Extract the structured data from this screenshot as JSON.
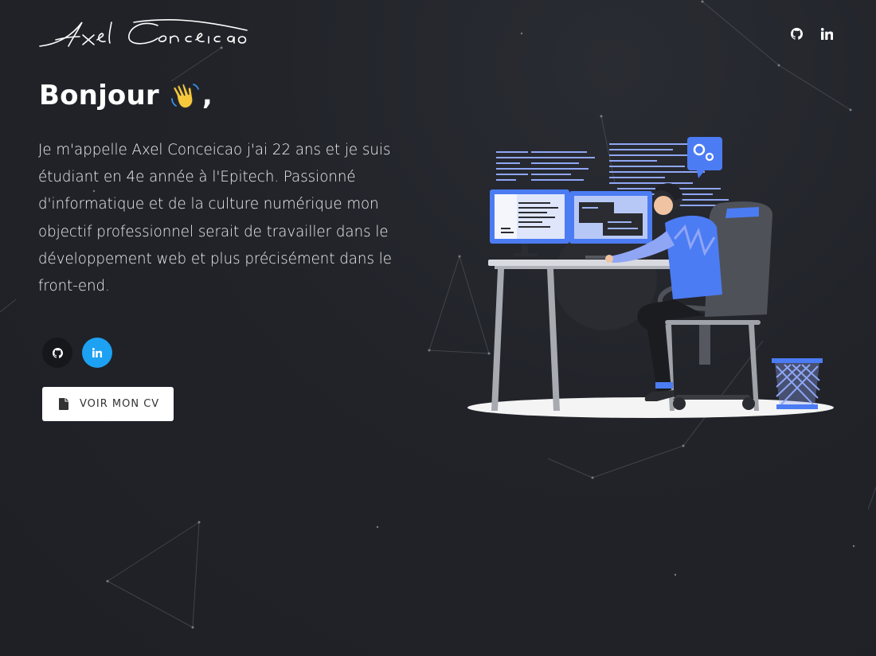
{
  "header": {
    "logo_text": "Axel Conceicao",
    "icons": [
      "github-icon",
      "linkedin-icon"
    ]
  },
  "hero": {
    "greeting": "Bonjour",
    "emoji": "waving-hand",
    "comma": ",",
    "intro": "Je m'appelle Axel Conceicao j'ai 22 ans et je suis étudiant en 4e année à l'Epitech. Passionné d'informatique et de la culture numérique mon objectif professionnel serait de travailler dans le développement web et plus précisément dans le front-end."
  },
  "social": {
    "github_icon": "github-icon",
    "linkedin_icon": "linkedin-icon",
    "github_bg": "#15171b",
    "linkedin_bg": "#1da1f2"
  },
  "cv_button": {
    "label": "VOIR MON CV",
    "icon": "document-icon"
  },
  "colors": {
    "background": "#1f2126",
    "accent_blue": "#4c7cf3",
    "text": "#ffffff"
  }
}
